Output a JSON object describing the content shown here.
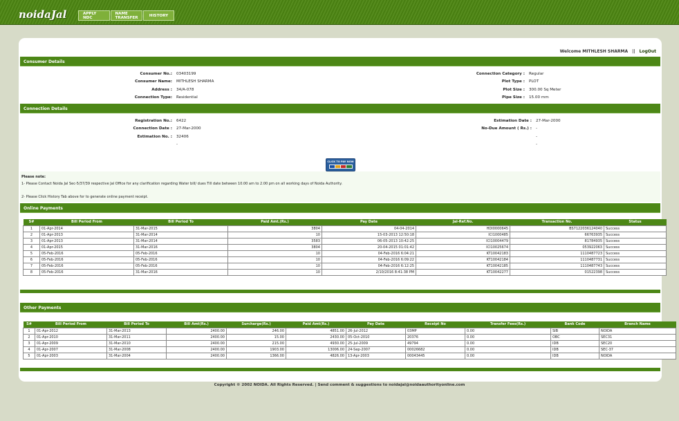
{
  "header": {
    "logo": "noidaJal",
    "tabs": [
      "APPLY NDC",
      "NAME TRANSFER",
      "HISTORY"
    ]
  },
  "welcome": {
    "text": "Welcome MITHLESH SHARMA",
    "separator": "||",
    "logout": "LogOut"
  },
  "consumer": {
    "title": "Consumer Details",
    "left": [
      {
        "k": "Consumer No.:",
        "v": "03403199"
      },
      {
        "k": "Consumer Name:",
        "v": "MITHLESH SHARMA"
      },
      {
        "k": "Address :",
        "v": "34/A-078"
      },
      {
        "k": "Connection Type:",
        "v": "Residential"
      }
    ],
    "right": [
      {
        "k": "Connection Category :",
        "v": "Regular"
      },
      {
        "k": "Plot Type :",
        "v": "PLOT"
      },
      {
        "k": "Plot Size :",
        "v": "300.00 Sq Meter"
      },
      {
        "k": "Pipe Size :",
        "v": "15.00 mm"
      }
    ]
  },
  "connection": {
    "title": "Connection Details",
    "left": [
      {
        "k": "Registration No.:",
        "v": "6422"
      },
      {
        "k": "Connection Date :",
        "v": "27-Mar-2000"
      },
      {
        "k": "Estimation No. :",
        "v": "32406"
      },
      {
        "k": "",
        "v": "-"
      }
    ],
    "right": [
      {
        "k": "Estimation Date :",
        "v": "27-Mar-2000"
      },
      {
        "k": "No-Due Amount ( Rs.) :",
        "v": "-"
      },
      {
        "k": "",
        "v": "-"
      },
      {
        "k": "",
        "v": "-"
      }
    ]
  },
  "paybutton": {
    "label": "CLICK TO PAY NOW"
  },
  "note": {
    "title": "Please note:",
    "line1": "1- Please Contact Noida Jal Sec-5/37/39 respective Jal Office for any clarification regarding Water bill/ dues Till date between 10.00 am to 2.00 pm on all working days of Noida Authority.",
    "line2": "2- Please Click History Tab above for to generate online payment receipt."
  },
  "online": {
    "title": "Online Payments",
    "headers": [
      "S#",
      "Bill Period From",
      "Bill Period To",
      "Paid Amt.(Rs.)",
      "Pay Date",
      "Jal-Ref.No.",
      "Transaction No.",
      "Status"
    ],
    "rows": [
      [
        "1",
        "01-Apr-2014",
        "31-Mar-2015",
        "3804",
        "04-04-2014",
        "HDI0000645",
        "BS7122036124040",
        "Success"
      ],
      [
        "2",
        "01-Apr-2013",
        "31-Mar-2014",
        "10",
        "15-03-2013 12:50:18",
        "ICI1000485",
        "66763935",
        "Success"
      ],
      [
        "3",
        "01-Apr-2013",
        "31-Mar-2014",
        "3583",
        "06-05-2013 10:42:25",
        "ICI10004479",
        "81784935",
        "Success"
      ],
      [
        "4",
        "01-Apr-2015",
        "31-Mar-2016",
        "3804",
        "20-04-2015 01:01:42",
        "ICI10025674",
        "053922063",
        "Success"
      ],
      [
        "5",
        "05-Feb-2016",
        "05-Feb-2016",
        "10",
        "04-Feb-2016 6:04:21",
        "KT10042183",
        "1110487723",
        "Success"
      ],
      [
        "6",
        "05-Feb-2016",
        "05-Feb-2016",
        "10",
        "04-Feb-2016 6:09:22",
        "KT10042184",
        "1110487731",
        "Success"
      ],
      [
        "7",
        "05-Feb-2016",
        "05-Feb-2016",
        "10",
        "04-Feb-2016 6:12:25",
        "KT10042185",
        "1110487743",
        "Success"
      ],
      [
        "8",
        "05-Feb-2016",
        "31-Mar-2016",
        "10",
        "2/10/2016 8:41:38 PM",
        "KT10042277",
        "01522398",
        "Success"
      ]
    ]
  },
  "other": {
    "title": "Other Payments",
    "headers": [
      "S#",
      "Bill Period From",
      "Bill Period To",
      "Bill Amt(Rs.)",
      "Surcharge(Rs.)",
      "Paid Amt(Rs.)",
      "Pay Date",
      "Receipt No",
      "Transfer Fees(Rs.)",
      "Bank Code",
      "Branch Name"
    ],
    "rows": [
      [
        "1",
        "01-Apr-2012",
        "31-Mar-2013",
        "2400.00",
        "246.00",
        "4851.00",
        "26-Jul-2012",
        "03MP",
        "0.00",
        "SIB",
        "NOIDA"
      ],
      [
        "2",
        "01-Apr-2010",
        "31-Mar-2011",
        "2400.00",
        "15.00",
        "2430.00",
        "05-Oct-2010",
        "20376",
        "0.00",
        "OBC",
        "SEC31"
      ],
      [
        "3",
        "01-Apr-2009",
        "31-Mar-2010",
        "2400.00",
        "215.00",
        "4930.00",
        "25-Jul-2009",
        "49794",
        "0.00",
        "IDB",
        "SEC20"
      ],
      [
        "4",
        "01-Apr-2007",
        "31-Mar-2008",
        "2400.00",
        "1903.00",
        "13006.00",
        "24-Sep-2007",
        "00026682",
        "0.00",
        "IDB",
        "SEC-37"
      ],
      [
        "5",
        "01-Apr-2003",
        "31-Mar-2004",
        "2400.00",
        "1366.00",
        "4826.00",
        "13-Apr-2003",
        "00043445",
        "0.00",
        "IDB",
        "NOIDA"
      ]
    ]
  },
  "footer": {
    "text": "Copyright © 2002 NOIDA. All Rights Reserved. | Send comment & suggestions to noidajal@noidaauthorityonline.com"
  }
}
